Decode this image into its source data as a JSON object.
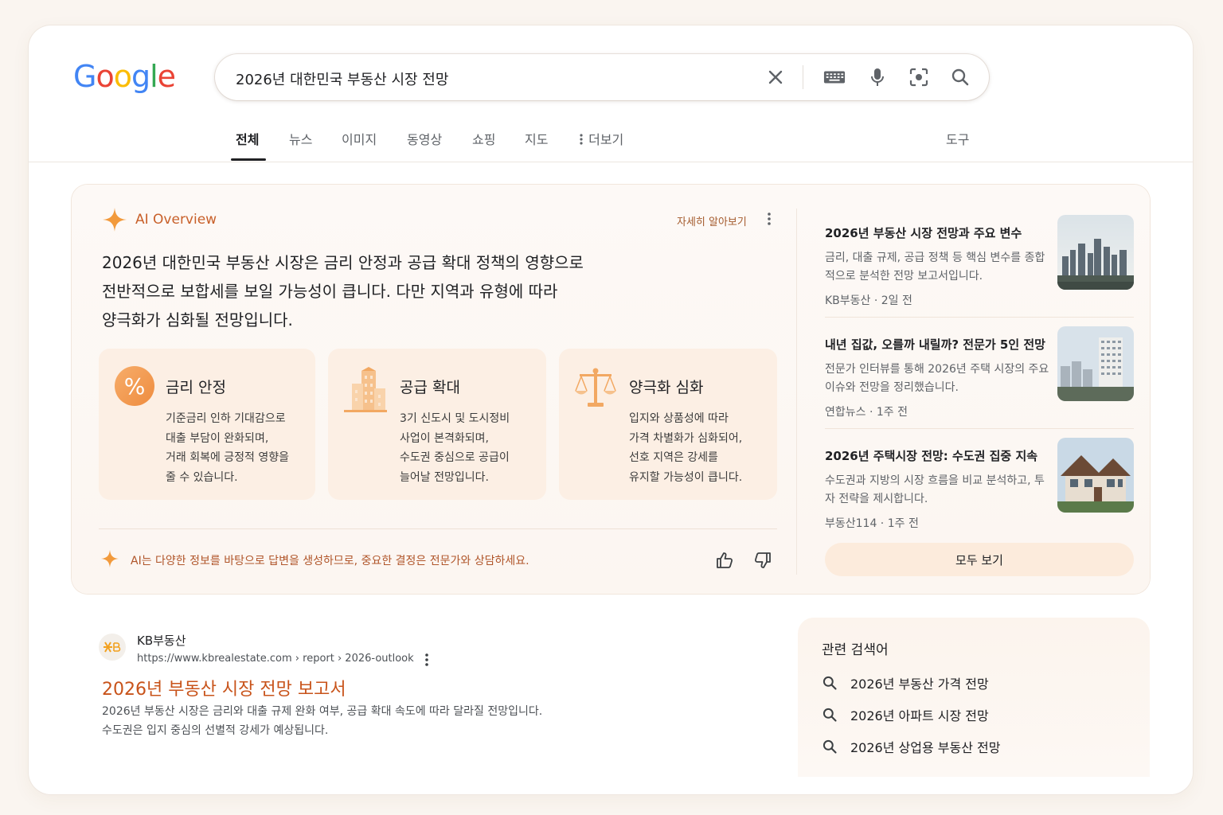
{
  "logo": {
    "letters": [
      "G",
      "o",
      "o",
      "g",
      "l",
      "e"
    ],
    "colors": [
      "#4285F4",
      "#EA4335",
      "#FBBC05",
      "#4285F4",
      "#34A853",
      "#EA4335"
    ]
  },
  "search": {
    "query": "2026년 대한민국 부동산 시장 전망"
  },
  "tabs": [
    {
      "label": "전체"
    },
    {
      "label": "뉴스"
    },
    {
      "label": "이미지"
    },
    {
      "label": "동영상"
    },
    {
      "label": "쇼핑"
    },
    {
      "label": "지도"
    },
    {
      "label": "더보기"
    }
  ],
  "tools_label": "도구",
  "ai_overview": {
    "title": "AI Overview",
    "more_label": "자세히 알아보기",
    "summary_lines": [
      "2026년 대한민국 부동산 시장은 금리 안정과 공급 확대 정책의 영향으로",
      "전반적으로 보합세를 보일 가능성이 큽니다. 다만 지역과 유형에 따라",
      "양극화가 심화될 전망입니다."
    ],
    "cards": [
      {
        "title": "금리 안정",
        "icon": "%",
        "desc": [
          "기준금리 인하 기대감으로",
          "대출 부담이 완화되며,",
          "거래 회복에 긍정적 영향을",
          "줄 수 있습니다."
        ]
      },
      {
        "title": "공급 확대",
        "desc": [
          "3기 신도시 및 도시정비",
          "사업이 본격화되며,",
          "수도권 중심으로 공급이",
          "늘어날 전망입니다."
        ]
      },
      {
        "title": "양극화 심화",
        "desc": [
          "입지와 상품성에 따라",
          "가격 차별화가 심화되어,",
          "선호 지역은 강세를",
          "유지할 가능성이 큽니다."
        ]
      }
    ],
    "footnote": "AI는 다양한 정보를 바탕으로 답변을 생성하므로, 중요한 결정은 전문가와 상담하세요.",
    "sources": [
      {
        "title": "2026년 부동산 시장 전망과 주요 변수",
        "desc": "금리, 대출 규제, 공급 정책 등 핵심 변수를 종합적으로 분석한 전망 보고서입니다.",
        "meta": "KB부동산 · 2일 전"
      },
      {
        "title": "내년 집값, 오를까 내릴까? 전문가 5인 전망",
        "desc": "전문가 인터뷰를 통해 2026년 주택 시장의 주요 이슈와 전망을 정리했습니다.",
        "meta": "연합뉴스 · 1주 전"
      },
      {
        "title": "2026년 주택시장 전망: 수도권 집중 지속",
        "desc": "수도권과 지방의 시장 흐름을 비교 분석하고, 투자 전략을 제시합니다.",
        "meta": "부동산114 · 1주 전"
      }
    ],
    "see_all_label": "모두 보기"
  },
  "result": {
    "site_name": "KB부동산",
    "url": "https://www.kbrealestate.com › report › 2026-outlook",
    "title": "2026년 부동산 시장 전망 보고서",
    "snippet_lines": [
      "2026년 부동산 시장은 금리와 대출 규제 완화 여부, 공급 확대 속도에 따라 달라질 전망입니다.",
      "수도권은 입지 중심의 선별적 강세가 예상됩니다."
    ]
  },
  "related": {
    "title": "관련 검색어",
    "items": [
      "2026년 부동산 가격 전망",
      "2026년 아파트 시장 전망",
      "2026년 상업용 부동산 전망"
    ]
  },
  "colors": {
    "accent": "#c8602a",
    "card_bg": "#fcefe4",
    "title_link": "#c8531a"
  }
}
